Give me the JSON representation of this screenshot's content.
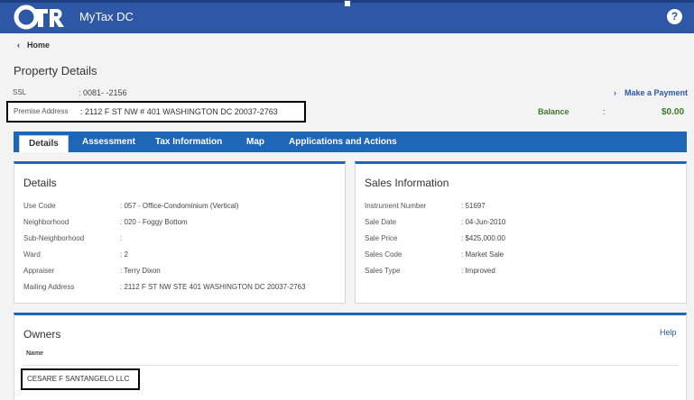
{
  "header": {
    "app_title": "MyTax DC",
    "help_symbol": "?"
  },
  "nav": {
    "home_label": "Home"
  },
  "property": {
    "title": "Property Details",
    "ssl_label": "SSL",
    "ssl_value": ": 0081-  -2156",
    "premise_label": "Premise Address",
    "premise_value": ": 2112 F ST NW # 401 WASHINGTON DC 20037-2763",
    "make_payment": "Make a Payment",
    "balance_label": "Balance",
    "balance_colon": ":",
    "balance_value": "$0.00"
  },
  "tabs": [
    {
      "label": "Details"
    },
    {
      "label": "Assessment"
    },
    {
      "label": "Tax Information"
    },
    {
      "label": "Map"
    },
    {
      "label": "Applications and Actions"
    }
  ],
  "details": {
    "title": "Details",
    "rows": [
      {
        "label": "Use Code",
        "value": ": 057 - Office-Condominium (Vertical)"
      },
      {
        "label": "Neighborhood",
        "value": ": 020 - Foggy Bottom"
      },
      {
        "label": "Sub-Neighborhood",
        "value": ":"
      },
      {
        "label": "Ward",
        "value": ": 2"
      },
      {
        "label": "Appraiser",
        "value": ": Terry Dixon"
      },
      {
        "label": "Mailing Address",
        "value": ": 2112 F ST NW STE 401 WASHINGTON DC 20037-2763"
      }
    ]
  },
  "sales": {
    "title": "Sales Information",
    "rows": [
      {
        "label": "Instrument Number",
        "value": ": 51697"
      },
      {
        "label": "Sale Date",
        "value": ": 04-Jun-2010"
      },
      {
        "label": "Sale Price",
        "value": ": $425,000.00"
      },
      {
        "label": "Sales Code",
        "value": ": Market Sale"
      },
      {
        "label": "Sales Type",
        "value": ": Improved"
      }
    ]
  },
  "owners": {
    "title": "Owners",
    "help": "Help",
    "name_header": "Name",
    "names": [
      "CESARE F SANTANGELO LLC"
    ]
  },
  "colors": {
    "brand_blue": "#2e57a6",
    "tab_blue": "#1e66b8",
    "balance_green": "#3d7a2a"
  }
}
